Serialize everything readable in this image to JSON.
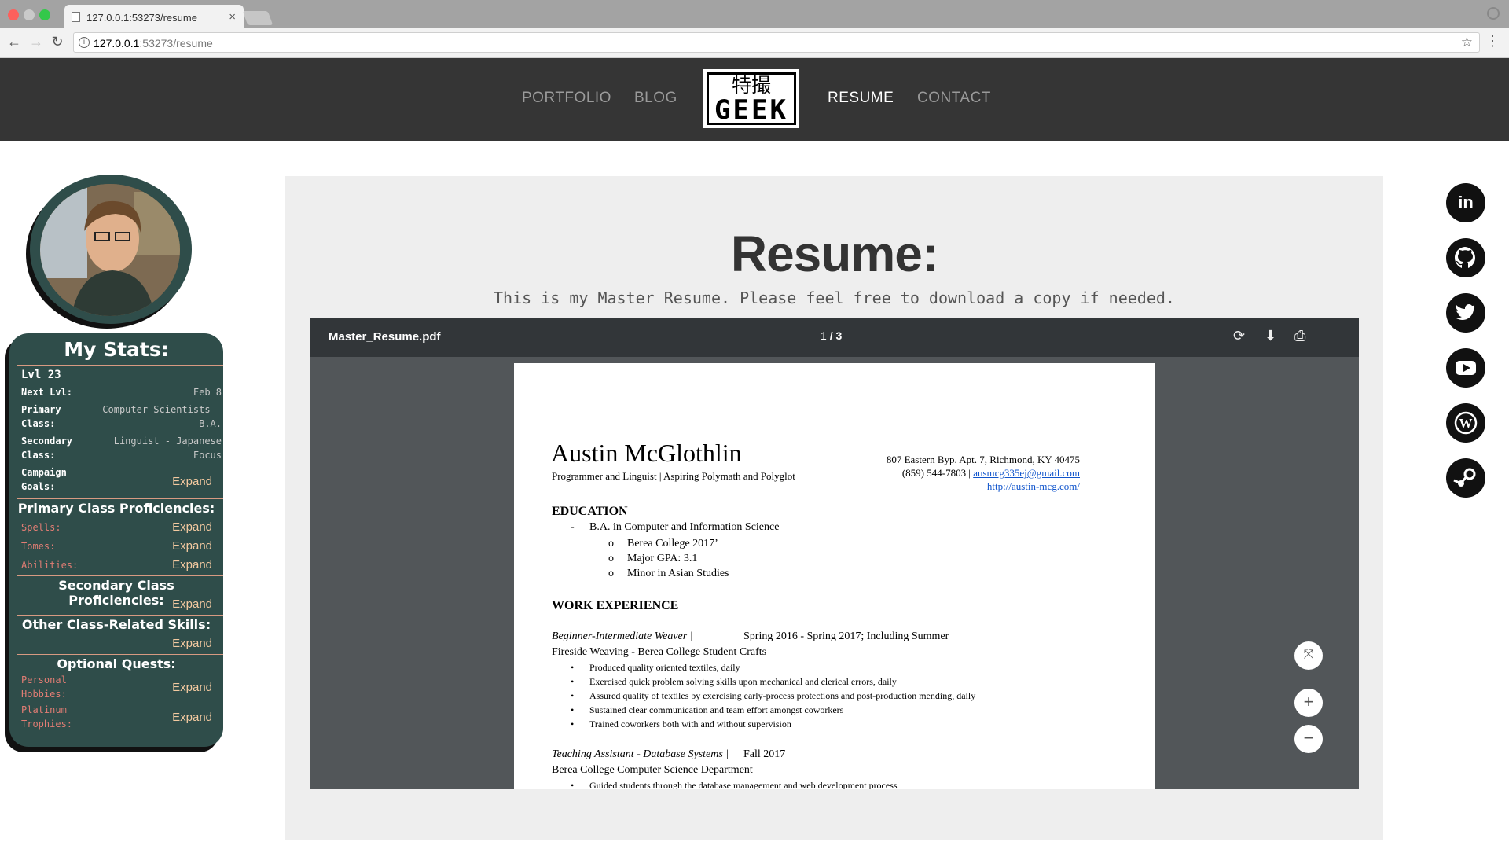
{
  "browser": {
    "tab_title": "127.0.0.1:53273/resume",
    "url_host": "127.0.0.1",
    "url_rest": ":53273/resume"
  },
  "site": {
    "nav": [
      "PORTFOLIO",
      "BLOG",
      "RESUME",
      "CONTACT"
    ],
    "active_nav": "RESUME",
    "logo_jp": "特撮",
    "logo_en": "GEEK"
  },
  "stats": {
    "title": "My Stats:",
    "level": "Lvl 23",
    "rows": [
      {
        "label": "Next Lvl:",
        "value": "Feb 8"
      },
      {
        "label": "Primary Class:",
        "value": "Computer Scientists - B.A."
      },
      {
        "label": "Secondary Class:",
        "value": "Linguist - Japanese Focus"
      },
      {
        "label": "Campaign Goals:",
        "value": "Expand"
      }
    ],
    "primary_title": "Primary Class Proficiencies:",
    "primary_items": [
      {
        "label": "Spells:",
        "value": "Expand"
      },
      {
        "label": "Tomes:",
        "value": "Expand"
      },
      {
        "label": "Abilities:",
        "value": "Expand"
      }
    ],
    "secondary_title": "Secondary Class Proficiencies:",
    "secondary_expand": "Expand",
    "other_title": "Other Class-Related Skills:",
    "other_expand": "Expand",
    "quests_title": "Optional Quests:",
    "quest_items": [
      {
        "label": "Personal Hobbies:",
        "value": "Expand"
      },
      {
        "label": "Platinum Trophies:",
        "value": "Expand"
      }
    ]
  },
  "main": {
    "title": "Resume:",
    "subtitle": "This is my Master Resume. Please feel free to download a copy if needed."
  },
  "pdf": {
    "filename": "Master_Resume.pdf",
    "page_current": "1",
    "page_total": "3",
    "name": "Austin McGlothlin",
    "tagline": "Programmer and Linguist | Aspiring Polymath and Polyglot",
    "address": "807 Eastern Byp. Apt. 7, Richmond, KY 40475",
    "phone": "(859) 544-7803 | ",
    "email": "ausmcg335ej@gmail.com",
    "website": "http://austin-mcg.com/",
    "education_heading": "EDUCATION",
    "degree": "B.A. in Computer and Information Science",
    "edu_items": [
      "Berea College 2017’",
      "Major GPA: 3.1",
      "Minor in Asian Studies"
    ],
    "work_heading": "WORK EXPERIENCE",
    "job1_title": "Beginner-Intermediate Weaver |",
    "job1_dates": "Spring 2016 - Spring 2017; Including Summer",
    "job1_org": "Fireside Weaving - Berea College Student Crafts",
    "job1_bullets": [
      "Produced quality oriented textiles, daily",
      "Exercised quick problem solving skills upon mechanical and clerical errors, daily",
      "Assured quality of textiles by exercising early-process protections and post-production mending, daily",
      "Sustained clear communication and team effort amongst coworkers",
      "Trained coworkers both with and without supervision"
    ],
    "job2_title": "Teaching Assistant - Database Systems |",
    "job2_dates": "Fall 2017",
    "job2_org": "Berea College Computer Science Department",
    "job2_bullets": [
      "Guided students through the database management and web development process"
    ]
  },
  "social": [
    "linkedin-icon",
    "github-icon",
    "twitter-icon",
    "youtube-icon",
    "wordpress-icon",
    "steam-icon"
  ]
}
